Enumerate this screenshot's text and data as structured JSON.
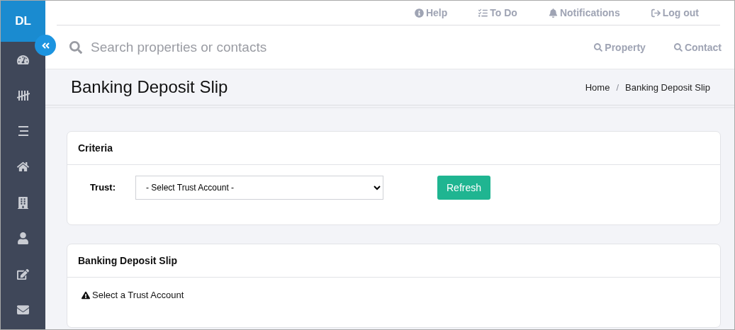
{
  "avatar": {
    "initials": "DL"
  },
  "top_links": [
    {
      "label": "Help"
    },
    {
      "label": "To Do"
    },
    {
      "label": "Notifications"
    },
    {
      "label": "Log out"
    }
  ],
  "search": {
    "placeholder": "Search properties or contacts"
  },
  "search_scopes": [
    {
      "label": "Property"
    },
    {
      "label": "Contact"
    }
  ],
  "page": {
    "title": "Banking Deposit Slip"
  },
  "breadcrumb_separator": "/",
  "breadcrumb": [
    {
      "label": "Home"
    },
    {
      "label": "Banking Deposit Slip"
    }
  ],
  "criteria": {
    "title": "Criteria",
    "label": "Trust:",
    "select": "- Select Trust Account -",
    "button": "Refresh"
  },
  "result": {
    "title": "Banking Deposit Slip",
    "message": "Select a Trust Account"
  }
}
